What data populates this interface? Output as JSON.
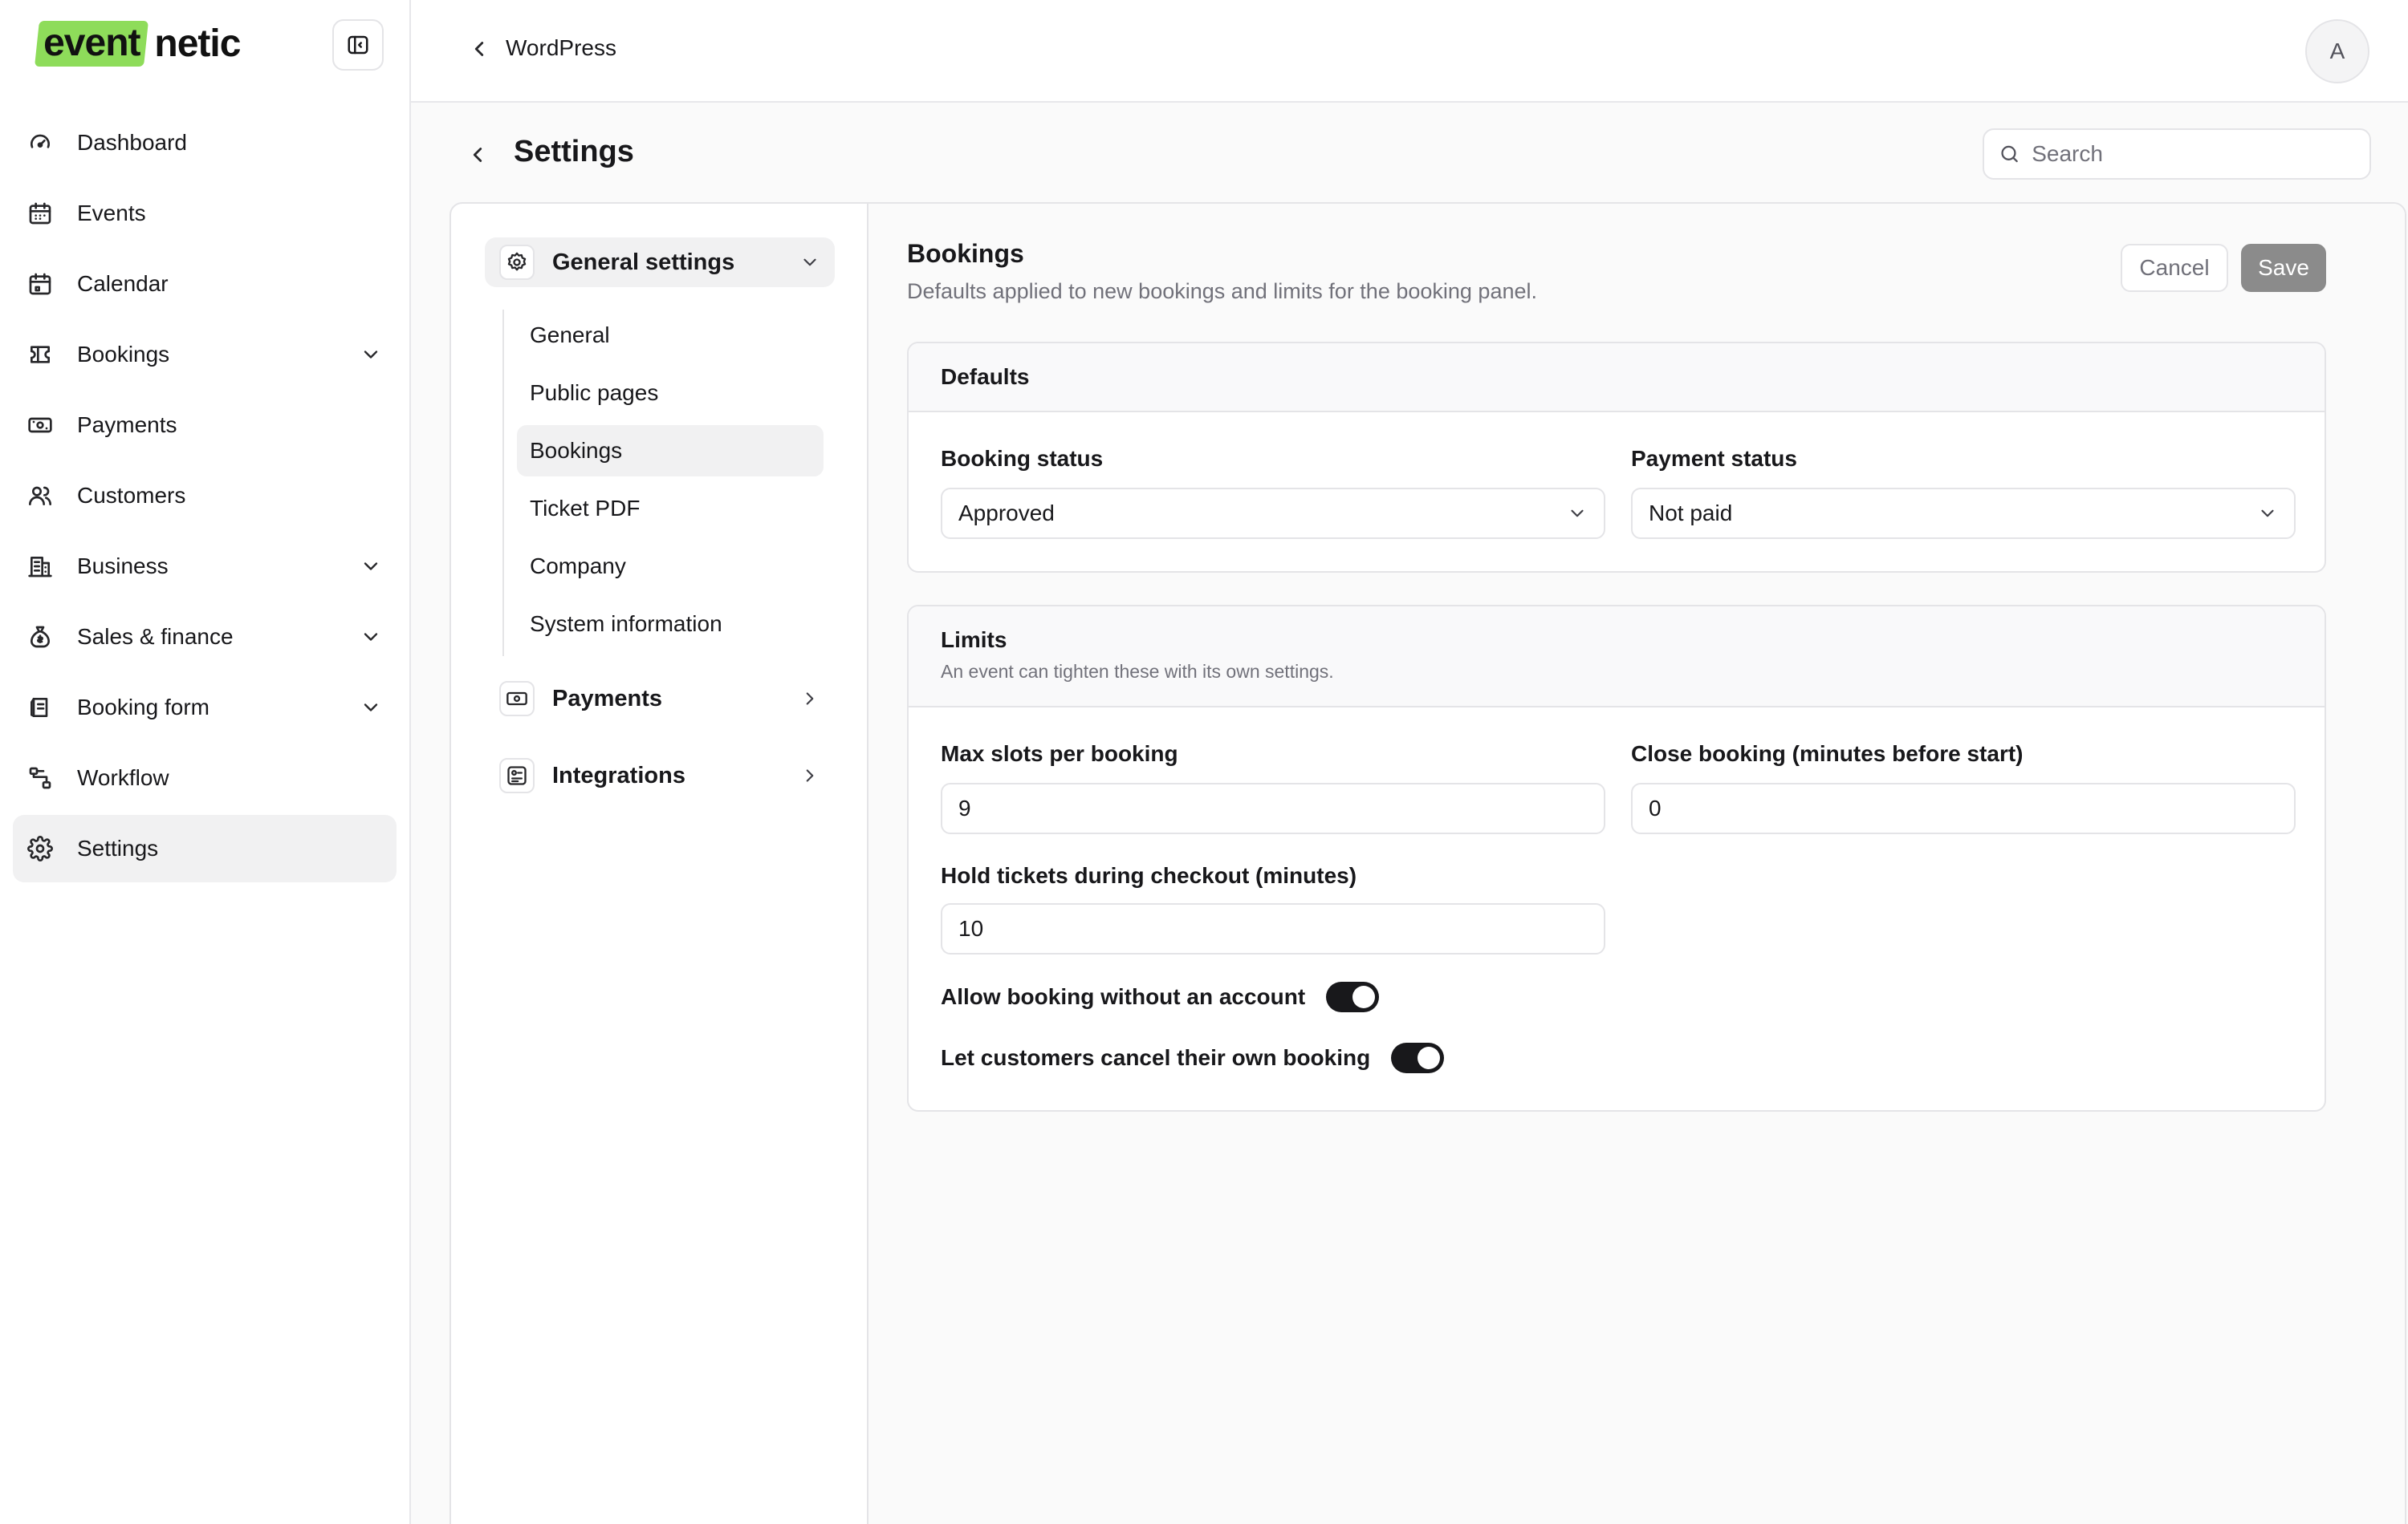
{
  "app": {
    "logo_part1": "event",
    "logo_part2": "netic",
    "accent_color": "#8edc5a"
  },
  "sidebar": {
    "items": [
      {
        "label": "Dashboard",
        "icon": "gauge-icon",
        "has_chevron": false
      },
      {
        "label": "Events",
        "icon": "calendar-grid-icon",
        "has_chevron": false
      },
      {
        "label": "Calendar",
        "icon": "calendar-icon",
        "has_chevron": false
      },
      {
        "label": "Bookings",
        "icon": "ticket-icon",
        "has_chevron": true
      },
      {
        "label": "Payments",
        "icon": "banknote-icon",
        "has_chevron": false
      },
      {
        "label": "Customers",
        "icon": "users-icon",
        "has_chevron": false
      },
      {
        "label": "Business",
        "icon": "building-icon",
        "has_chevron": true
      },
      {
        "label": "Sales & finance",
        "icon": "money-bag-icon",
        "has_chevron": true
      },
      {
        "label": "Booking form",
        "icon": "form-icon",
        "has_chevron": true
      },
      {
        "label": "Workflow",
        "icon": "workflow-icon",
        "has_chevron": false
      },
      {
        "label": "Settings",
        "icon": "gear-icon",
        "has_chevron": false,
        "active": true
      }
    ]
  },
  "topbar": {
    "breadcrumb": "WordPress",
    "avatar_initial": "A"
  },
  "page": {
    "title": "Settings",
    "search_placeholder": "Search"
  },
  "subnav": {
    "general_group": "General settings",
    "general_items": [
      "General",
      "Public pages",
      "Bookings",
      "Ticket PDF",
      "Company",
      "System information"
    ],
    "active_item": "Bookings",
    "payments_group": "Payments",
    "integrations_group": "Integrations"
  },
  "form": {
    "title": "Bookings",
    "subtitle": "Defaults applied to new bookings and limits for the booking panel.",
    "cancel_label": "Cancel",
    "save_label": "Save",
    "defaults": {
      "title": "Defaults",
      "booking_status_label": "Booking status",
      "booking_status_value": "Approved",
      "payment_status_label": "Payment status",
      "payment_status_value": "Not paid"
    },
    "limits": {
      "title": "Limits",
      "subtitle": "An event can tighten these with its own settings.",
      "max_slots_label": "Max slots per booking",
      "max_slots_value": "9",
      "close_booking_label": "Close booking (minutes before start)",
      "close_booking_value": "0",
      "hold_tickets_label": "Hold tickets during checkout (minutes)",
      "hold_tickets_value": "10",
      "allow_guest_label": "Allow booking without an account",
      "allow_guest_on": true,
      "self_cancel_label": "Let customers cancel their own booking",
      "self_cancel_on": true
    }
  }
}
